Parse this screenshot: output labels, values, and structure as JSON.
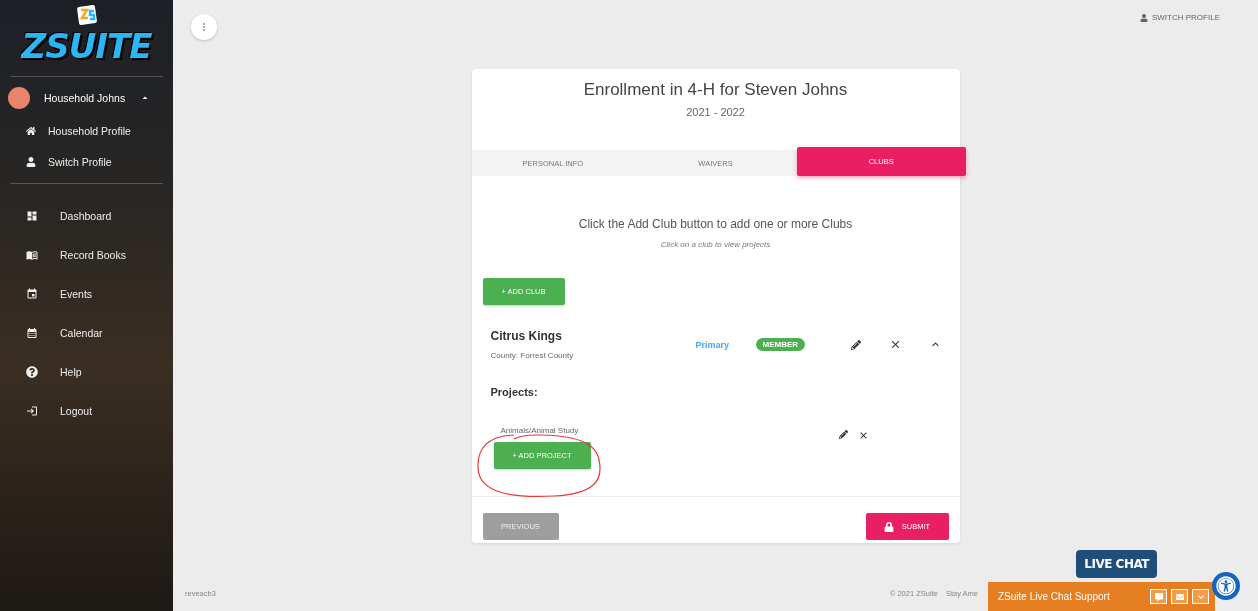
{
  "sidebar": {
    "logo": "ZSUITE",
    "account": {
      "name": "Household Johns",
      "expanded": true
    },
    "profile_items": [
      {
        "label": "Household Profile"
      },
      {
        "label": "Switch Profile"
      }
    ],
    "nav_items": [
      {
        "label": "Dashboard"
      },
      {
        "label": "Record Books"
      },
      {
        "label": "Events"
      },
      {
        "label": "Calendar"
      },
      {
        "label": "Help"
      },
      {
        "label": "Logout"
      }
    ]
  },
  "topbar": {
    "switch_profile": "SWITCH PROFILE"
  },
  "card": {
    "title": "Enrollment in 4-H for Steven Johns",
    "subtitle": "2021 - 2022",
    "tabs": [
      {
        "label": "PERSONAL INFO",
        "selected": false
      },
      {
        "label": "WAIVERS",
        "selected": false
      },
      {
        "label": "CLUBS",
        "selected": true
      }
    ],
    "instruction": "Click the Add Club button to add one or more Clubs",
    "hint": "Click on a club to view projects",
    "add_club": "+ ADD CLUB",
    "club": {
      "name": "Citrus Kings",
      "county": "County: Forrest County",
      "role": "Primary",
      "badge": "MEMBER",
      "expanded": true,
      "projects_heading": "Projects:",
      "projects": [
        {
          "name": "Animals/Animal Study"
        }
      ],
      "add_project": "+ ADD PROJECT"
    },
    "previous": "PREVIOUS",
    "submit": "SUBMIT"
  },
  "footer": {
    "version": "reveacb3",
    "copyright": "© 2021 ZSuite",
    "tagline": "Stay Ame"
  },
  "chat": {
    "bubble": "LIVE CHAT",
    "bar": "ZSuite Live Chat Support"
  }
}
